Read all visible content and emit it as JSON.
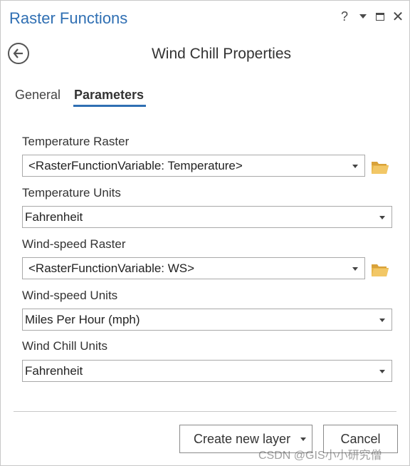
{
  "pane": {
    "title": "Raster Functions",
    "help_label": "?",
    "close_label": "✕"
  },
  "header": {
    "title": "Wind Chill Properties"
  },
  "tabs": [
    {
      "label": "General",
      "active": false
    },
    {
      "label": "Parameters",
      "active": true
    }
  ],
  "fields": [
    {
      "label": "Temperature Raster",
      "value": "<RasterFunctionVariable: Temperature>",
      "has_browse": true
    },
    {
      "label": "Temperature Units",
      "value": "Fahrenheit",
      "has_browse": false
    },
    {
      "label": "Wind-speed Raster",
      "value": "<RasterFunctionVariable: WS>",
      "has_browse": true
    },
    {
      "label": "Wind-speed Units",
      "value": "Miles Per Hour (mph)",
      "has_browse": false
    },
    {
      "label": "Wind Chill Units",
      "value": "Fahrenheit",
      "has_browse": false
    }
  ],
  "footer": {
    "create_label": "Create new layer",
    "cancel_label": "Cancel"
  },
  "watermark": "CSDN @GIS小小研究僧",
  "colors": {
    "accent": "#2f6fb3",
    "folder": "#e8b64a"
  }
}
